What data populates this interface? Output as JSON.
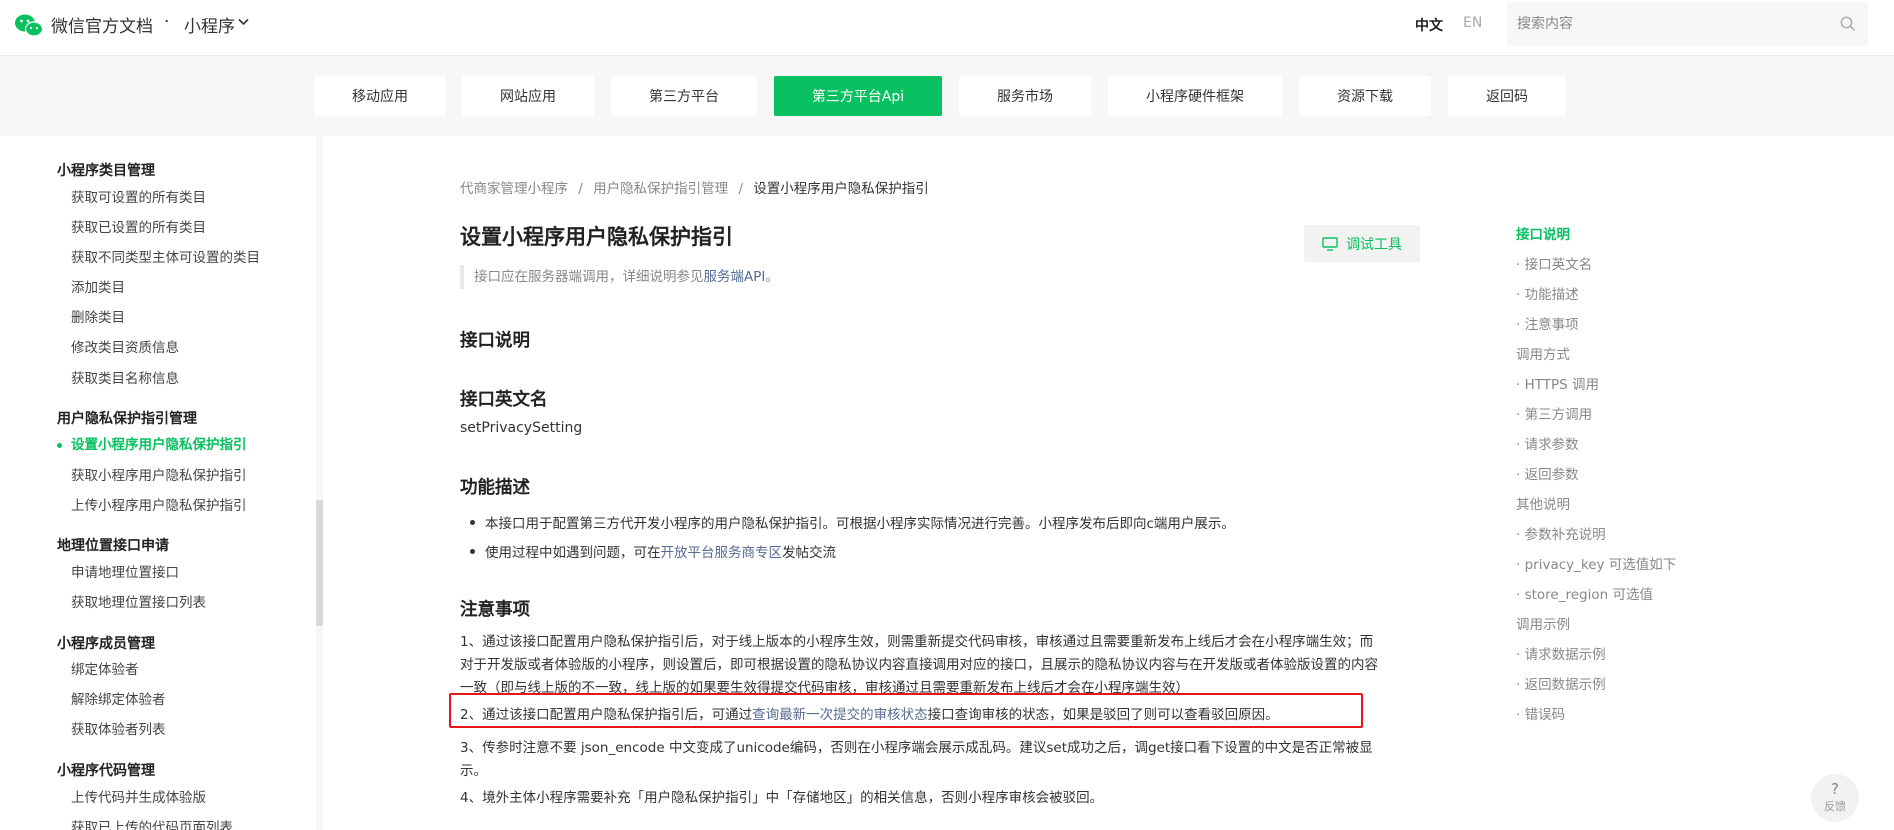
{
  "header": {
    "brand": "微信官方文档",
    "separator": "·",
    "product": "小程序",
    "lang_zh": "中文",
    "lang_en": "EN",
    "search_placeholder": "搜索内容"
  },
  "nav": {
    "tabs": [
      {
        "label": "移动应用"
      },
      {
        "label": "网站应用"
      },
      {
        "label": "第三方平台"
      },
      {
        "label": "第三方平台Api",
        "active": true
      },
      {
        "label": "服务市场"
      },
      {
        "label": "小程序硬件框架"
      },
      {
        "label": "资源下载"
      },
      {
        "label": "返回码"
      }
    ]
  },
  "sidebar": {
    "groups": [
      {
        "title": "小程序类目管理",
        "items": [
          "获取可设置的所有类目",
          "获取已设置的所有类目",
          "获取不同类型主体可设置的类目",
          "添加类目",
          "删除类目",
          "修改类目资质信息",
          "获取类目名称信息"
        ]
      },
      {
        "title": "用户隐私保护指引管理",
        "items": [
          "设置小程序用户隐私保护指引",
          "获取小程序用户隐私保护指引",
          "上传小程序用户隐私保护指引"
        ],
        "active_index": 0
      },
      {
        "title": "地理位置接口申请",
        "items": [
          "申请地理位置接口",
          "获取地理位置接口列表"
        ]
      },
      {
        "title": "小程序成员管理",
        "items": [
          "绑定体验者",
          "解除绑定体验者",
          "获取体验者列表"
        ]
      },
      {
        "title": "小程序代码管理",
        "items": [
          "上传代码并生成体验版",
          "获取已上传的代码页面列表"
        ]
      }
    ]
  },
  "content": {
    "breadcrumb": [
      "代商家管理小程序",
      "用户隐私保护指引管理",
      "设置小程序用户隐私保护指引"
    ],
    "breadcrumb_sep": "/",
    "title": "设置小程序用户隐私保护指引",
    "debug_button": "调试工具",
    "notice_text": "接口应在服务器端调用，详细说明参见",
    "notice_link": "服务端API",
    "notice_end": "。",
    "sec_intro": "接口说明",
    "sec_name": "接口英文名",
    "api_name": "setPrivacySetting",
    "sec_func": "功能描述",
    "func_1": "本接口用于配置第三方代开发小程序的用户隐私保护指引。可根据小程序实际情况进行完善。小程序发布后即向c端用户展示。",
    "func_2_pre": "使用过程中如遇到问题，可在",
    "func_2_link": "开放平台服务商专区",
    "func_2_post": "发帖交流",
    "sec_notes": "注意事项",
    "note_1a": "1、通过该接口配置用户隐私保护指引后，对于线上版本的小程序生效，则需重新提交代码审核，审核通过且需要重新发布上线后才会在小程序端生效；而",
    "note_1b": "对于开发版或者体验版的小程序，则设置后，即可根据设置的隐私协议内容直接调用对应的接口，且展示的隐私协议内容与在开发版或者体验版设置的内容",
    "note_1c": "一致（即与线上版的不一致，线上版的如果要生效得提交代码审核，审核通过且需要重新发布上线后才会在小程序端生效）",
    "note_2_pre": "2、通过该接口配置用户隐私保护指引后，可通过",
    "note_2_link": "查询最新一次提交的审核状态",
    "note_2_post": "接口查询审核的状态，如果是驳回了则可以查看驳回原因。",
    "note_3a": "3、传参时注意不要 json_encode 中文变成了unicode编码，否则在小程序端会展示成乱码。建议set成功之后，调get接口看下设置的中文是否正常被显",
    "note_3b": "示。",
    "note_4": "4、境外主体小程序需要补充「用户隐私保护指引」中「存储地区」的相关信息，否则小程序审核会被驳回。"
  },
  "toc": {
    "items": [
      {
        "label": "接口说明",
        "active": true
      },
      {
        "label": "· 接口英文名"
      },
      {
        "label": "· 功能描述"
      },
      {
        "label": "· 注意事项"
      },
      {
        "label": "调用方式"
      },
      {
        "label": "· HTTPS 调用"
      },
      {
        "label": "· 第三方调用"
      },
      {
        "label": "· 请求参数"
      },
      {
        "label": "· 返回参数"
      },
      {
        "label": "其他说明"
      },
      {
        "label": "· 参数补充说明"
      },
      {
        "label": "· privacy_key 可选值如下"
      },
      {
        "label": "· store_region 可选值"
      },
      {
        "label": "调用示例"
      },
      {
        "label": "· 请求数据示例"
      },
      {
        "label": "· 返回数据示例"
      },
      {
        "label": "· 错误码"
      }
    ]
  },
  "feedback": {
    "icon": "?",
    "label": "反馈"
  },
  "colors": {
    "accent": "#07c160",
    "link": "#576b95",
    "highlight_box": "#e8141c"
  }
}
